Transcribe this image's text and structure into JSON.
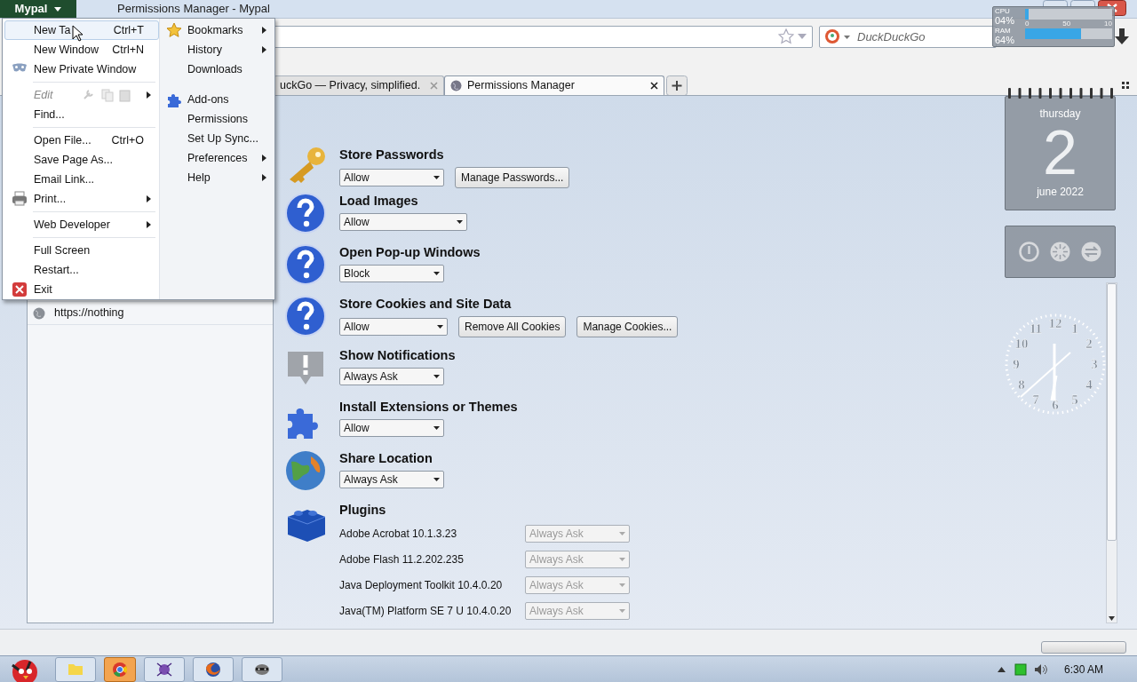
{
  "window": {
    "title": "Permissions Manager - Mypal",
    "app_button": "Mypal"
  },
  "toolbar": {
    "search_placeholder": "DuckDuckGo"
  },
  "tabs": [
    {
      "label": "uckGo — Privacy, simplified.",
      "selected": false
    },
    {
      "label": "Permissions Manager",
      "selected": true
    }
  ],
  "sites": [
    {
      "label": "https://nothing",
      "selected": false
    }
  ],
  "permissions": [
    {
      "kind": "key",
      "title": "Store Passwords",
      "value": "Allow",
      "buttons": [
        "Manage Passwords..."
      ]
    },
    {
      "kind": "question",
      "title": "Load Images",
      "value": "Allow"
    },
    {
      "kind": "question",
      "title": "Open Pop-up Windows",
      "value": "Block"
    },
    {
      "kind": "question",
      "title": "Store Cookies and Site Data",
      "value": "Allow",
      "buttons": [
        "Remove All Cookies",
        "Manage Cookies..."
      ]
    },
    {
      "kind": "bubble",
      "title": "Show Notifications",
      "value": "Always Ask"
    },
    {
      "kind": "puzzle",
      "title": "Install Extensions or Themes",
      "value": "Allow"
    },
    {
      "kind": "globe",
      "title": "Share Location",
      "value": "Always Ask"
    },
    {
      "kind": "brick",
      "title": "Plugins"
    }
  ],
  "plugins": [
    {
      "name": "Adobe Acrobat 10.1.3.23",
      "value": "Always Ask",
      "disabled": true
    },
    {
      "name": "Adobe Flash 11.2.202.235",
      "value": "Always Ask",
      "disabled": true
    },
    {
      "name": "Java Deployment Toolkit 10.4.0.20",
      "value": "Always Ask",
      "disabled": true
    },
    {
      "name": "Java(TM) Platform SE 7 U 10.4.0.20",
      "value": "Always Ask",
      "disabled": true
    }
  ],
  "app_menu": {
    "left": [
      {
        "kind": "plain",
        "label": "New Ta",
        "shortcut": "Ctrl+T",
        "selected": true
      },
      {
        "kind": "plain",
        "label": "New Window",
        "shortcut": "Ctrl+N",
        "selected": false
      },
      {
        "kind": "mask",
        "label": "New Private Window",
        "selected": false
      },
      {
        "kind": "separator"
      },
      {
        "kind": "edit",
        "label": "Edit",
        "disabled": true,
        "submenu": true,
        "selected": false
      },
      {
        "kind": "plain",
        "label": "Find...",
        "selected": false
      },
      {
        "kind": "separator"
      },
      {
        "kind": "plain",
        "label": "Open File...",
        "shortcut": "Ctrl+O",
        "selected": false
      },
      {
        "kind": "plain",
        "label": "Save Page As...",
        "selected": false
      },
      {
        "kind": "plain",
        "label": "Email Link...",
        "selected": false
      },
      {
        "kind": "printer",
        "label": "Print...",
        "submenu": true,
        "selected": false
      },
      {
        "kind": "separator"
      },
      {
        "kind": "plain",
        "label": "Web Developer",
        "submenu": true,
        "selected": false
      },
      {
        "kind": "separator"
      },
      {
        "kind": "plain",
        "label": "Full Screen",
        "selected": false
      },
      {
        "kind": "plain",
        "label": "Restart...",
        "selected": false
      },
      {
        "kind": "exit",
        "label": "Exit",
        "selected": false
      }
    ],
    "right": [
      {
        "kind": "star",
        "label": "Bookmarks",
        "submenu": true,
        "selected": false
      },
      {
        "kind": "plain",
        "label": "History",
        "submenu": true,
        "selected": false
      },
      {
        "kind": "plain",
        "label": "Downloads",
        "selected": false
      },
      {
        "kind": "separator"
      },
      {
        "kind": "puzzle",
        "label": "Add-ons",
        "selected": false
      },
      {
        "kind": "plain",
        "label": "Permissions",
        "selected": false
      },
      {
        "kind": "plain",
        "label": "Set Up Sync...",
        "selected": false
      },
      {
        "kind": "plain",
        "label": "Preferences",
        "submenu": true,
        "selected": false
      },
      {
        "kind": "plain",
        "label": "Help",
        "submenu": true,
        "selected": false
      }
    ]
  },
  "meter_gadget": {
    "cpu": {
      "label": "CPU",
      "value": "04%",
      "level": 0.04
    },
    "ram": {
      "label": "RAM",
      "value": "64%",
      "level": 0.64
    },
    "scale": [
      "0",
      "50",
      "10"
    ]
  },
  "calendar_gadget": {
    "weekday": "thursday",
    "day": "2",
    "month": "june 2022"
  },
  "clock_gadget": {
    "numerals": [
      "11",
      "12",
      "1",
      "10",
      "2",
      "9",
      "3",
      "8",
      "4",
      "7",
      "5",
      "6"
    ]
  },
  "taskbar": {
    "time": "6:30 AM",
    "buttons": [
      {
        "kind": "folder",
        "selected": false
      },
      {
        "kind": "chrome",
        "selected": true
      },
      {
        "kind": "spider",
        "selected": false
      },
      {
        "kind": "firefox",
        "selected": false
      },
      {
        "kind": "raccoon",
        "selected": false
      }
    ]
  }
}
